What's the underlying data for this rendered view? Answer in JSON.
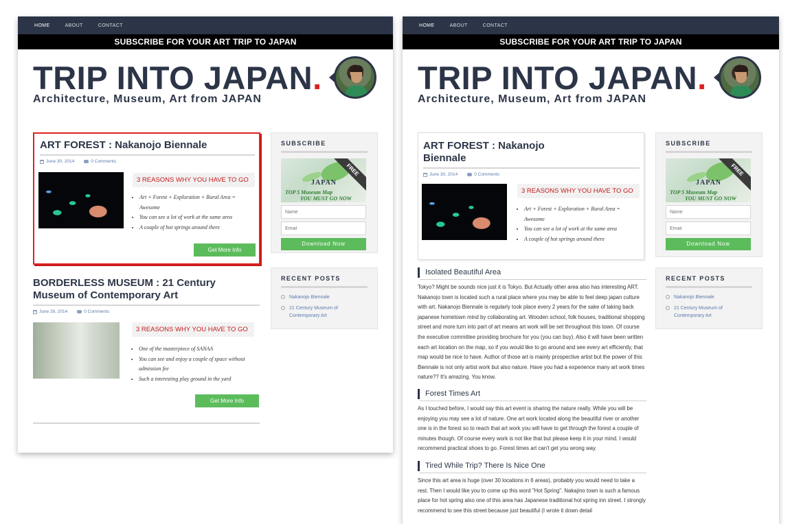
{
  "nav": {
    "items": [
      "HOME",
      "ABOUT",
      "CONTACT"
    ]
  },
  "subscribe_bar": "SUBSCRIBE FOR YOUR ART TRIP TO JAPAN",
  "site": {
    "title": "TRIP INTO JAPAN",
    "title_dot": ".",
    "tagline": "Architecture, Museum, Art from JAPAN"
  },
  "sidebar": {
    "subscribe": {
      "title": "SUBSCRIBE",
      "promo": {
        "free": "FREE",
        "japan": "JAPAN",
        "line1": "TOP 5 Museum Map",
        "line2": "YOU MUST GO NOW"
      },
      "name_placeholder": "Name",
      "email_placeholder": "Email",
      "button": "Download Now"
    },
    "recent": {
      "title": "RECENT POSTS",
      "items": [
        "Nakanojo Biennale",
        "21 Century Museum of Contemporary Art"
      ]
    }
  },
  "left": {
    "post1": {
      "title": "ART FOREST : Nakanojo Biennale",
      "date": "June 30, 2014",
      "comments": "0 Comments",
      "reasons": "3 REASONS WHY YOU HAVE TO GO",
      "bullets": [
        "Art + Forest + Exploration + Rural Area = Awesome",
        "You can see a lot of work at the same area",
        "A couple of hot springs around there"
      ],
      "button": "Get More Info"
    },
    "post2": {
      "title": "BORDERLESS MUSEUM : 21 Century Museum of Contemporary Art",
      "date": "June 28, 2014",
      "comments": "0 Comments",
      "reasons": "3 REASONS WHY YOU HAVE TO GO",
      "bullets": [
        "One of the masterpiece of SANAA",
        "You can see and enjoy a couple of space without admission fee",
        "Such a interesting play ground in the yard"
      ],
      "button": "Get More Info"
    }
  },
  "right": {
    "post": {
      "title": "ART FOREST : Nakanojo Biennale",
      "date": "June 30, 2014",
      "comments": "0 Comments",
      "reasons": "3 REASONS WHY YOU HAVE TO GO",
      "bullets": [
        "Art + Forest + Exploration + Rural Area = Awesome",
        "You can see a lot of work at the same area",
        "A couple of hot springs around there"
      ]
    },
    "sections": [
      {
        "heading": "Isolated Beautiful Area",
        "body": "Tokyo? Might be sounds nice just it is Tokyo. But Actually other area also has interesting ART. Nakanojo town is located such a rural place where you may be able to feel deep japan culture with art. Nakanojo Biennale is regularly took place every 2 years for the sake of taking back japanese hometown mind by collaborating art. Wooden school, folk houses, traditional shopping street and more turn into part of art means art work will be set throughout this town. Of course the executive committee providing brochure for you (you can buy). Also it will have been written each art location on the map, so if you would like to go around and see every art efficiently, that map would be nice to have. Author of those art is mainly prospective artist but the power of this Biennale is not only artist work but also nature. Have you had a experience many art work times nature?? It's amazing. You know."
      },
      {
        "heading": "Forest Times Art",
        "body": "As I touched before, I would say this art event is sharing the nature really. While you will be enjoying you may see a lot of nature. One art work located along the beautiful river or another one is in the forest so to reach that art work you will have to get through the forest a couple of minutes though. Of course every work is not like that but please keep it in your mind. I would recommend practical shoes to go. Forest times art can't get you wrong way."
      },
      {
        "heading": "Tired While Trip? There Is Nice One",
        "body": "Since this art area is huge (over 30 locations in 6 areas), probably you would need to take a rest. Then I would like you to come up this word \"Hot Spring\". Nakajino town is such a famous place for hot spring also one of this area has Japanese traditional hot spring inn street. I strongly recommend to see this street because just beautiful (I wrote it down detail"
      }
    ]
  }
}
